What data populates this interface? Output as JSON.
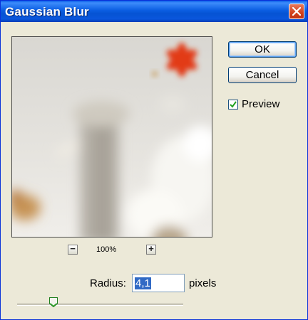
{
  "window": {
    "title": "Gaussian Blur"
  },
  "preview": {
    "zoom_level": "100%",
    "zoom_out_label": "−",
    "zoom_in_label": "+"
  },
  "buttons": {
    "ok": "OK",
    "cancel": "Cancel"
  },
  "preview_checkbox": {
    "label": "Preview",
    "checked": true
  },
  "radius": {
    "label": "Radius:",
    "value": "4,1",
    "unit": "pixels"
  },
  "slider": {
    "value": 0.22
  },
  "colors": {
    "titlebar": "#0553d3",
    "close_button": "#d2401c",
    "dialog_bg": "#ece9d8",
    "selection": "#316ac5"
  }
}
